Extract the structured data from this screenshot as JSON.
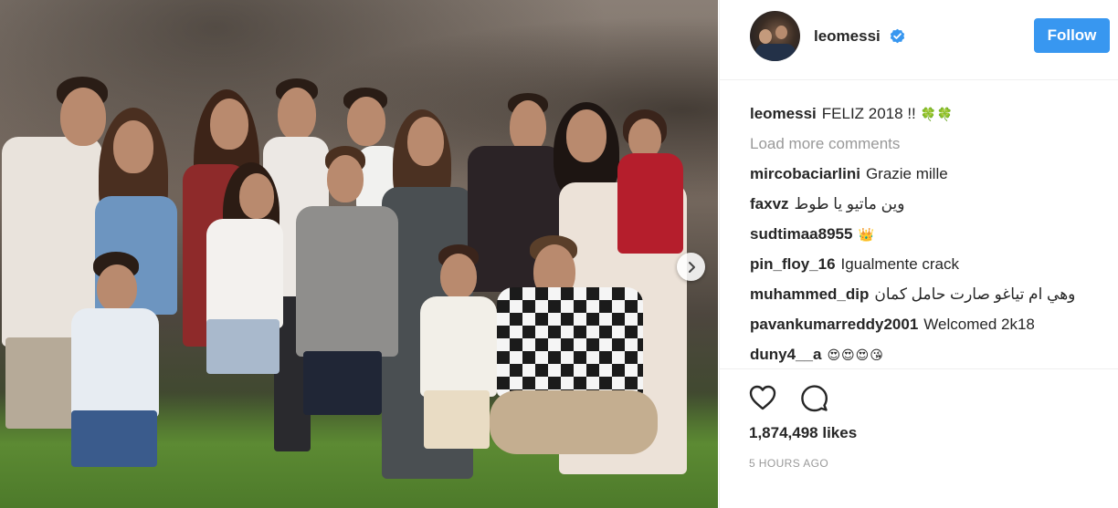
{
  "post": {
    "photo_alt": "Group photo",
    "next_icon": "chevron-right-icon"
  },
  "header": {
    "username": "leomessi",
    "verified_icon": "verified-badge-icon",
    "follow_label": "Follow",
    "accent": "#3897f0"
  },
  "caption": {
    "username": "leomessi",
    "text": "FELIZ 2018 !!",
    "emoji": "🍀🍀"
  },
  "load_more": "Load more comments",
  "comments": [
    {
      "user": "mircobaciarlini",
      "text": "Grazie mille",
      "rtl": false
    },
    {
      "user": "faxvz",
      "text": "وين ماتيو يا طوط",
      "rtl": true
    },
    {
      "user": "sudtimaa8955",
      "text": "👑",
      "rtl": false
    },
    {
      "user": "pin_floy_16",
      "text": "Igualmente crack",
      "rtl": false
    },
    {
      "user": "muhammed_dip",
      "text": "وهي ام تياغو صارت حامل كمان",
      "rtl": true
    },
    {
      "user": "pavankumarreddy2001",
      "text": "Welcomed 2k18",
      "rtl": false
    },
    {
      "user": "duny4__a",
      "text": "😍😍😍😘",
      "rtl": false
    }
  ],
  "actions": {
    "like_icon": "heart-icon",
    "comment_icon": "comment-bubble-icon",
    "likes": "1,874,498 likes",
    "time": "5 HOURS AGO"
  }
}
